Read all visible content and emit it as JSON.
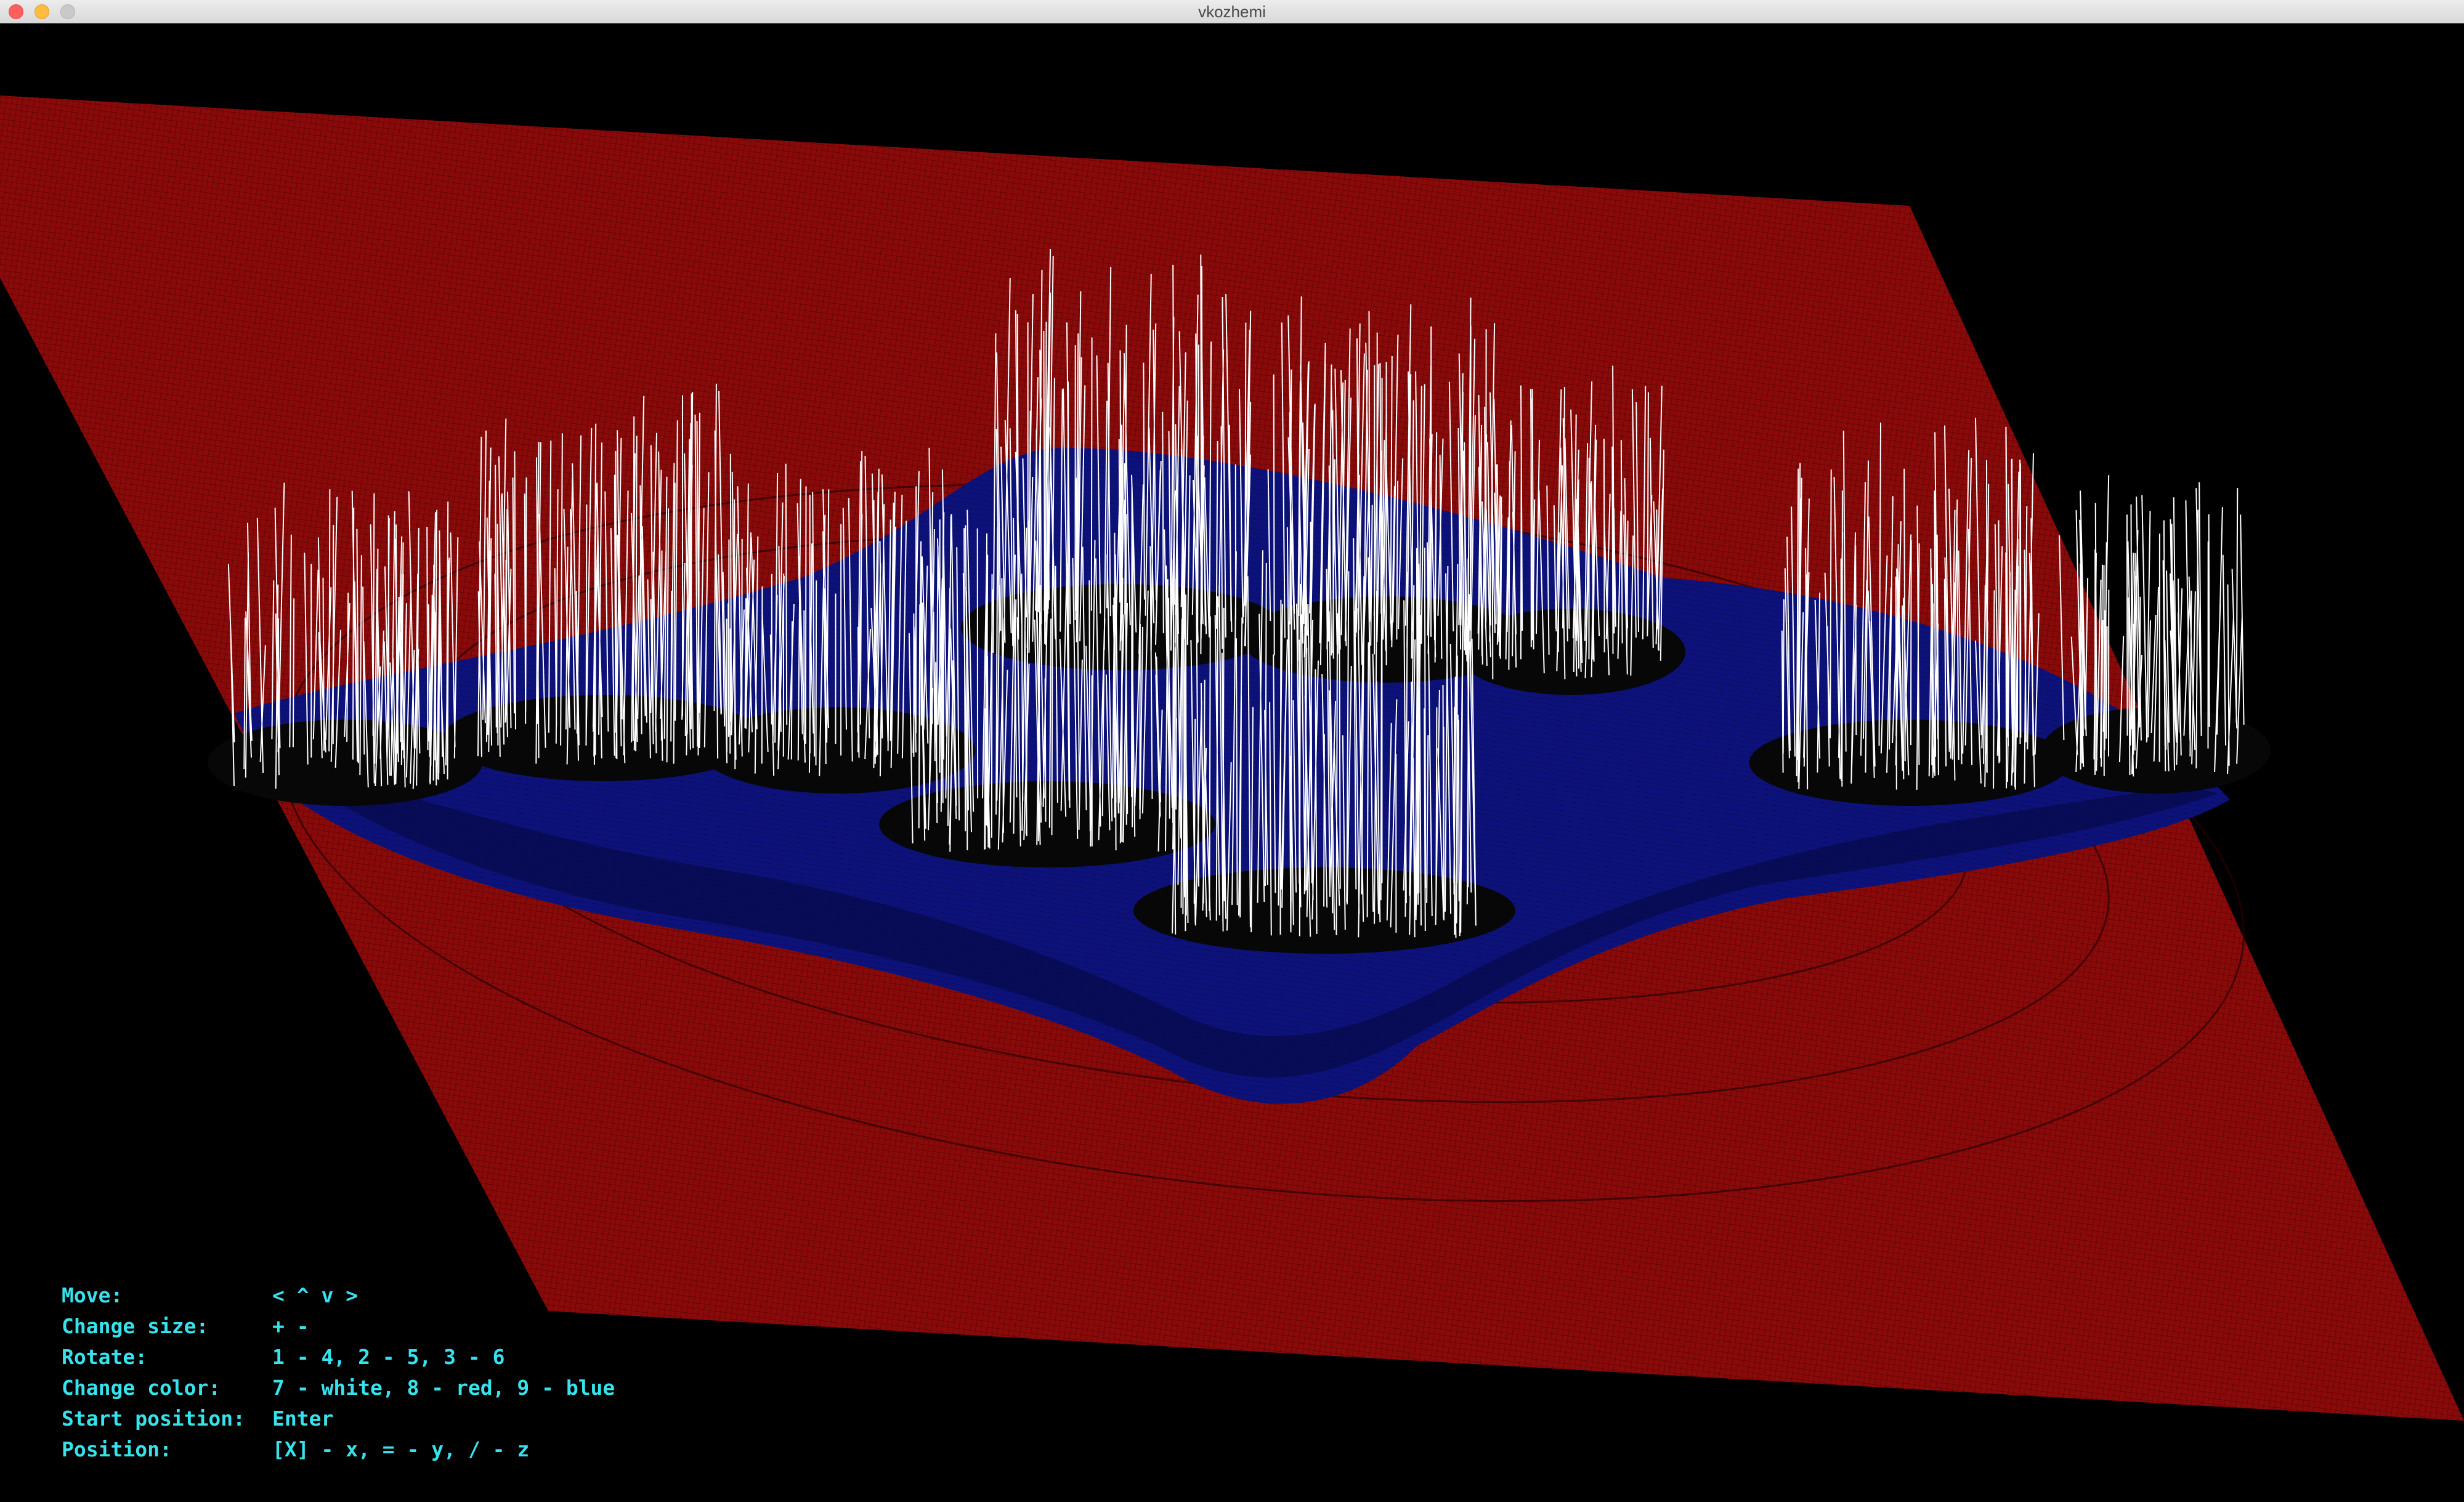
{
  "window": {
    "title": "vkozhemi"
  },
  "colors": {
    "plane": "#8a0a0a",
    "water": "#0d127a",
    "peaks": "#ffffff",
    "background": "#000000",
    "help_text": "#36e3ec"
  },
  "help": [
    {
      "label": "Move:",
      "value": "< ^ v >"
    },
    {
      "label": "Change size:",
      "value": "+ -"
    },
    {
      "label": "Rotate:",
      "value": "1 - 4, 2 - 5, 3 - 6"
    },
    {
      "label": "Change color:",
      "value": "7 - white, 8 - red, 9 - blue"
    },
    {
      "label": "Start position:",
      "value": "Enter"
    },
    {
      "label": "Position:",
      "value": "[X] - x, = - y, / - z"
    }
  ]
}
